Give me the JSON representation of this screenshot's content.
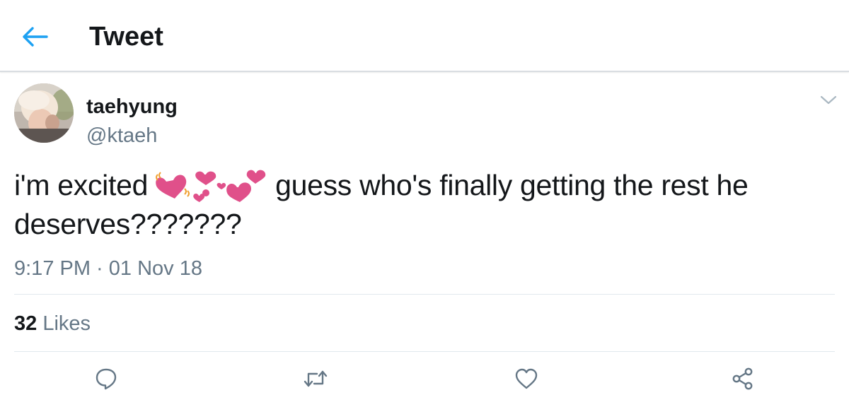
{
  "header": {
    "title": "Tweet",
    "back_icon": "arrow-left-icon",
    "accent_color": "#1da1f2"
  },
  "tweet": {
    "author": {
      "display_name": "taehyung",
      "handle": "@ktaeh"
    },
    "text_before_emoji": "i'm excited",
    "emoji": "hearts-emoji",
    "text_after_emoji": "guess who's finally getting the rest he deserves???????",
    "timestamp": "9:17 PM · 01 Nov 18",
    "stats": {
      "likes_count": "32",
      "likes_label": "Likes"
    },
    "actions": [
      "reply-icon",
      "retweet-icon",
      "like-icon",
      "share-icon"
    ]
  },
  "colors": {
    "text": "#14171a",
    "secondary": "#657786",
    "divider": "#e1e8ed",
    "heart_pink": "#e0508a"
  }
}
